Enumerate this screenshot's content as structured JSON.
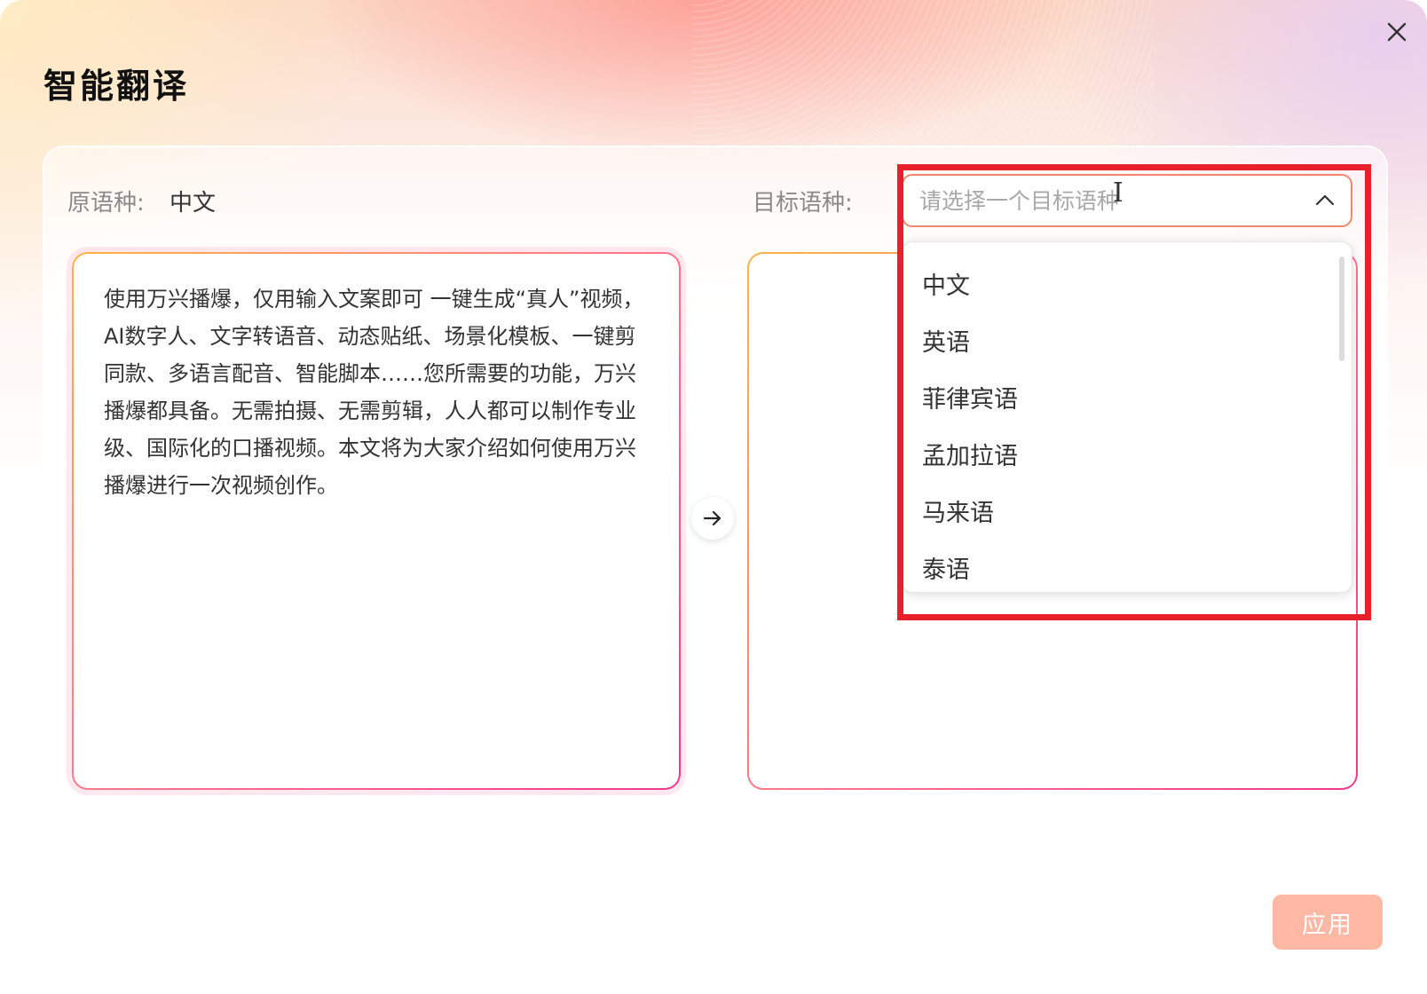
{
  "dialog": {
    "title": "智能翻译",
    "apply_label": "应用"
  },
  "source": {
    "label": "原语种:",
    "language": "中文",
    "text": "使用万兴播爆，仅用输入文案即可 一键生成“真人”视频，AI数字人、文字转语音、动态贴纸、场景化模板、一键剪同款、多语言配音、智能脚本……您所需要的功能，万兴播爆都具备。无需拍摄、无需剪辑，人人都可以制作专业级、国际化的口播视频。本文将为大家介绍如何使用万兴播爆进行一次视频创作。"
  },
  "target": {
    "label": "目标语种:",
    "placeholder": "请选择一个目标语种",
    "value": "",
    "options": [
      "中文",
      "英语",
      "菲律宾语",
      "孟加拉语",
      "马来语",
      "泰语"
    ]
  },
  "colors": {
    "highlight": "#e8202a",
    "apply_button": "#ffb8a4",
    "input_border": "#f3866b"
  },
  "icons": {
    "close": "close-icon",
    "arrow": "arrow-right-icon",
    "chevron": "chevron-up-icon",
    "cursor": "text-cursor-icon"
  }
}
